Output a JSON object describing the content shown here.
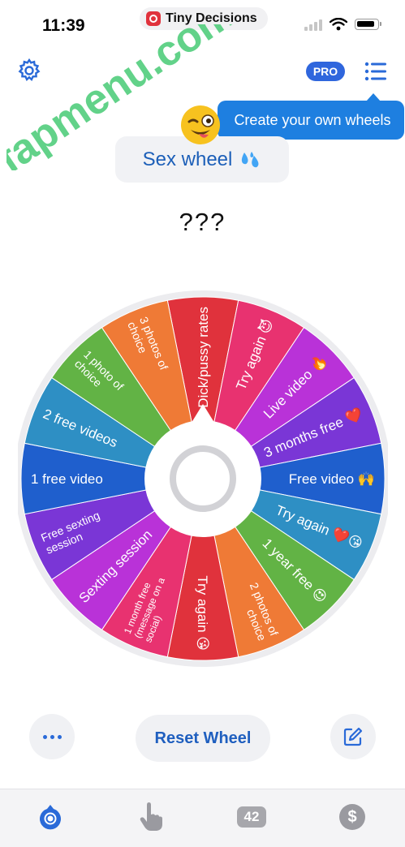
{
  "status_bar": {
    "time": "11:39",
    "app_name": "Tiny Decisions"
  },
  "header": {
    "pro_label": "PRO",
    "tooltip": "Create your own wheels"
  },
  "watermark": "fapmenu.com",
  "wheel_title": "Sex wheel",
  "result_text": "???",
  "wheel": {
    "segments": [
      {
        "label": "Dick/pussy rates",
        "color": "#e0323c"
      },
      {
        "label": "Try again 😈",
        "color": "#e83270"
      },
      {
        "label": "Live video 🔥",
        "color": "#b932d8"
      },
      {
        "label": "3 months free ❤️",
        "color": "#7a36d6"
      },
      {
        "label": "Free video 🙌",
        "color": "#1f5fcd"
      },
      {
        "label": "Try again ❤️😘",
        "color": "#2e8fc4"
      },
      {
        "label": "1 year free 😍",
        "color": "#62b345"
      },
      {
        "label": "2 photos of choice",
        "color": "#ef7a36"
      },
      {
        "label": "Try again 😘",
        "color": "#e0323c"
      },
      {
        "label": "1 month free (message on a social)",
        "color": "#e83270"
      },
      {
        "label": "Sexting session",
        "color": "#b932d8"
      },
      {
        "label": "Free sexting session",
        "color": "#7a36d6"
      },
      {
        "label": "1 free video",
        "color": "#1f5fcd"
      },
      {
        "label": "2 free videos",
        "color": "#2e8fc4"
      },
      {
        "label": "1 photo of choice",
        "color": "#62b345"
      },
      {
        "label": "3 photos of choice",
        "color": "#ef7a36"
      }
    ]
  },
  "controls": {
    "reset_label": "Reset Wheel"
  },
  "tab_bar": {
    "count": "42",
    "dollar": "$"
  },
  "colors": {
    "accent": "#1e7fe0",
    "title_blue": "#1c5fb8",
    "rim": "#ececef"
  }
}
